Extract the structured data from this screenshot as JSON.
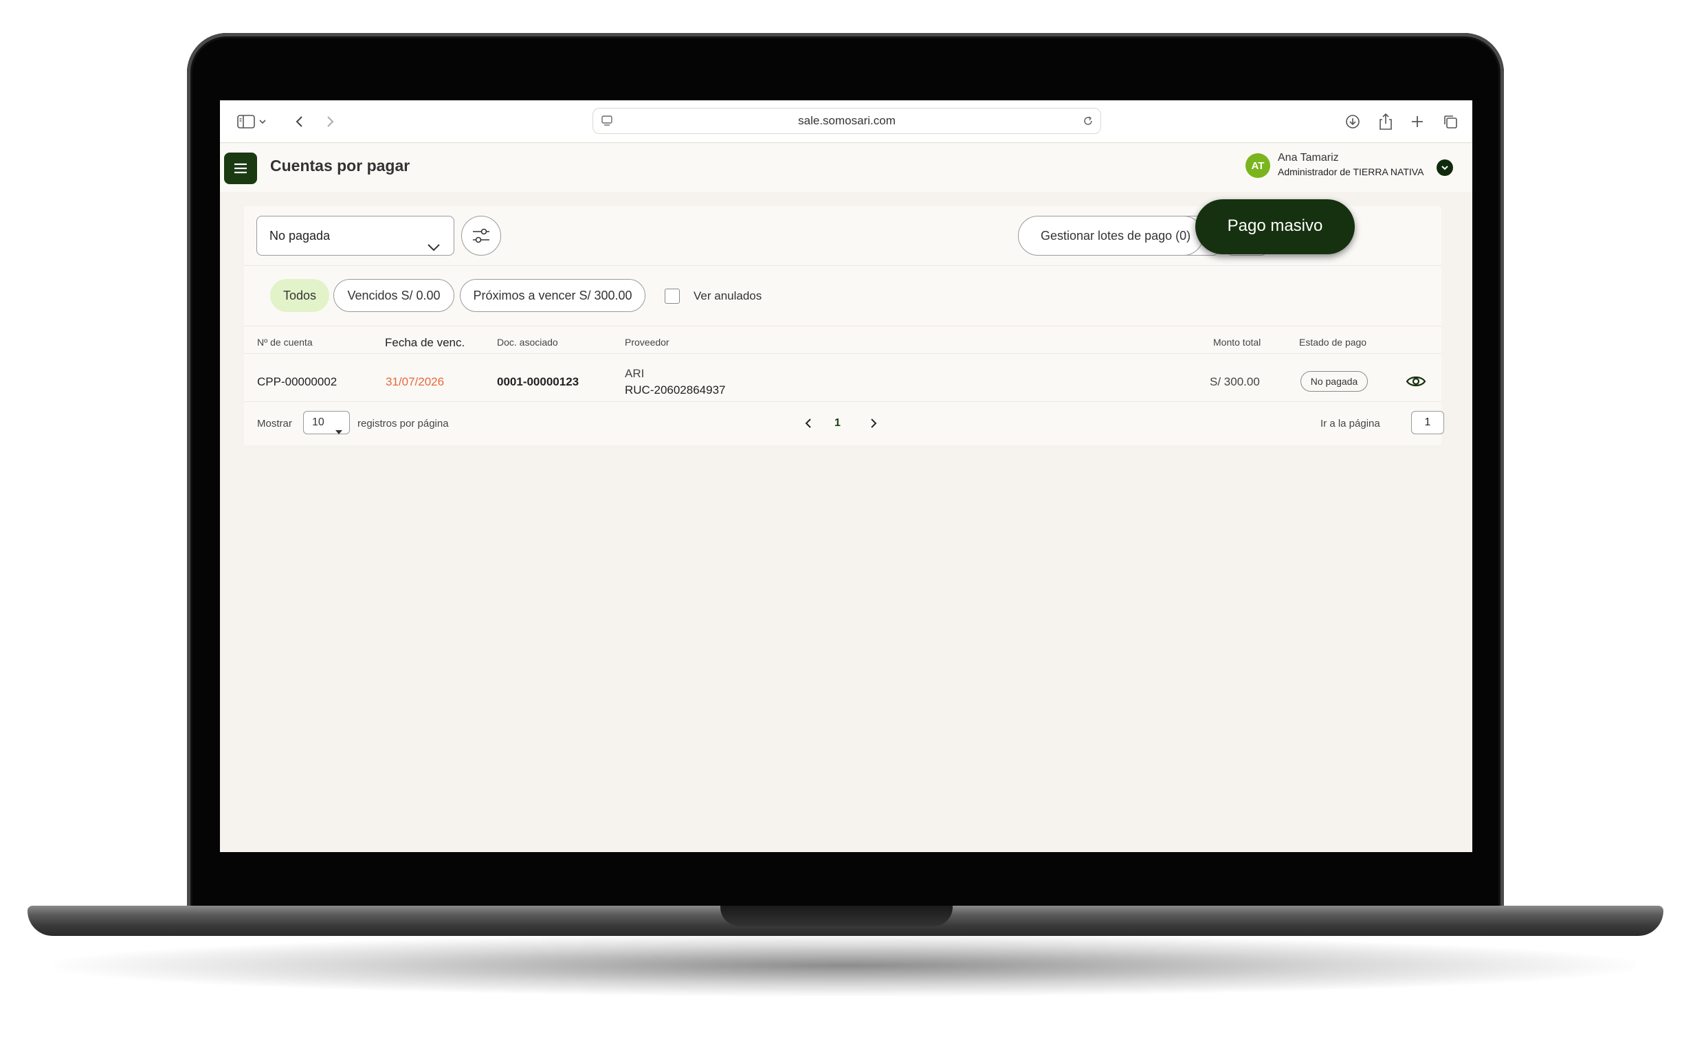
{
  "browser": {
    "url": "sale.somosari.com"
  },
  "header": {
    "title": "Cuentas por pagar",
    "user": {
      "initials": "AT",
      "name": "Ana Tamariz",
      "role": "Administrador de TIERRA NATIVA"
    }
  },
  "toolbar": {
    "status_filter": "No pagada",
    "lotes_label": "Gestionar lotes de pago (0)",
    "pago_masivo_label": "Pago masivo"
  },
  "chips": {
    "all": "Todos",
    "vencidos": "Vencidos S/ 0.00",
    "proximos": "Próximos a vencer S/ 300.00",
    "anulados_label": "Ver anulados"
  },
  "table": {
    "headers": {
      "cuenta": "Nº de cuenta",
      "fecha": "Fecha de venc.",
      "doc": "Doc. asociado",
      "proveedor": "Proveedor",
      "monto": "Monto total",
      "estado": "Estado de pago"
    },
    "rows": [
      {
        "cuenta": "CPP-00000002",
        "fecha": "31/07/2026",
        "doc": "0001-00000123",
        "proveedor_name": "ARI",
        "proveedor_ruc": "RUC-20602864937",
        "monto": "S/ 300.00",
        "estado": "No pagada"
      }
    ]
  },
  "pagination": {
    "show_label": "Mostrar",
    "per_page": "10",
    "per_page_suffix": "registros por página",
    "current_page": "1",
    "goto_label": "Ir a la página",
    "goto_value": "1"
  },
  "colors": {
    "brand_dark_green": "#1a3a12",
    "avatar_green": "#7ab51d",
    "chip_active_bg": "#e3f3c9",
    "due_date_orange": "#e8673a"
  }
}
